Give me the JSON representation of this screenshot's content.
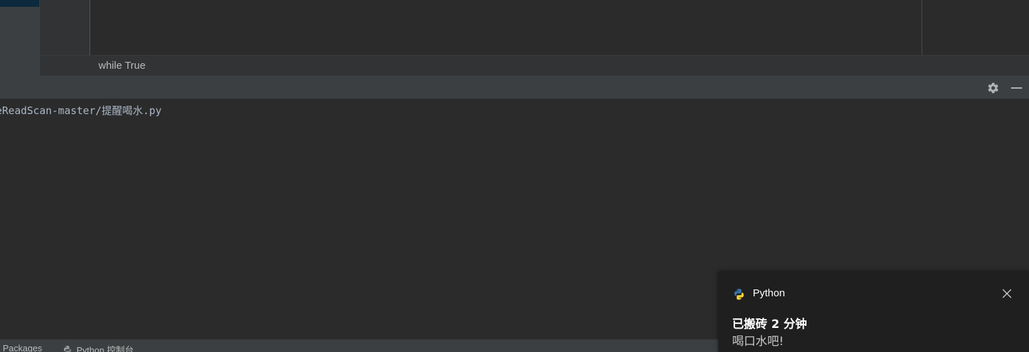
{
  "editor": {
    "breadcrumb": "while True"
  },
  "run_panel": {
    "settings_icon": "gear-icon",
    "minimize_icon": "minimize-icon"
  },
  "console": {
    "lines": [
      "eReadScan-master/提醒喝水.py"
    ]
  },
  "bottom_tabs": {
    "packages_label": "Packages",
    "python_console_label": "Python 控制台",
    "python_console_icon": "python-icon"
  },
  "notification": {
    "app_name": "Python",
    "app_icon": "python-logo-icon",
    "title": "已搬砖 2 分钟",
    "message": "喝口水吧!",
    "close_icon": "close-icon"
  },
  "colors": {
    "background": "#2b2b2b",
    "panel": "#3c3f41",
    "gutter": "#313335",
    "console_text": "#a9b7c6",
    "toast_background": "#1f1f1f",
    "python_blue": "#3776ab",
    "python_yellow": "#ffd43b"
  }
}
